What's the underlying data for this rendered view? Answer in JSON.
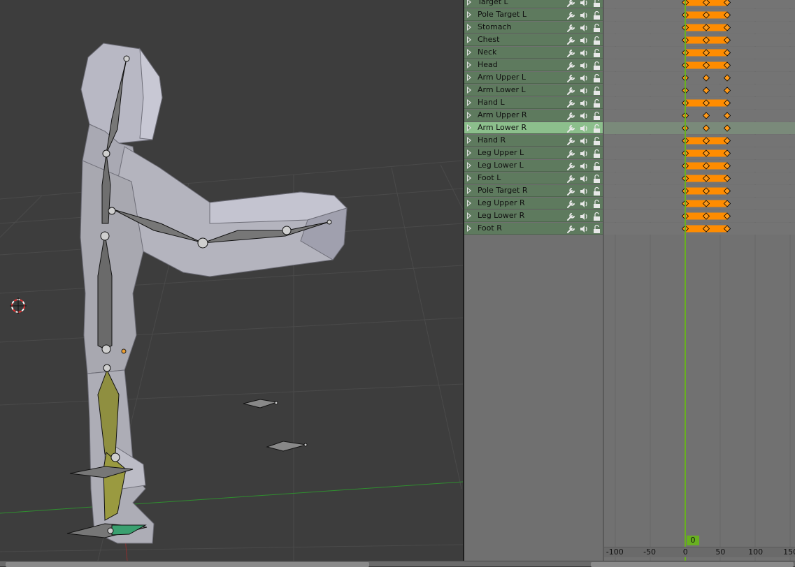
{
  "dopesheet": {
    "channels": [
      {
        "name": "Target L",
        "selected": false,
        "bar": true
      },
      {
        "name": "Pole Target L",
        "selected": false,
        "bar": true
      },
      {
        "name": "Stomach",
        "selected": false,
        "bar": true
      },
      {
        "name": "Chest",
        "selected": false,
        "bar": true
      },
      {
        "name": "Neck",
        "selected": false,
        "bar": true
      },
      {
        "name": "Head",
        "selected": false,
        "bar": true
      },
      {
        "name": "Arm Upper L",
        "selected": false,
        "bar": false
      },
      {
        "name": "Arm Lower L",
        "selected": false,
        "bar": false
      },
      {
        "name": "Hand L",
        "selected": false,
        "bar": true
      },
      {
        "name": "Arm Upper R",
        "selected": false,
        "bar": false
      },
      {
        "name": "Arm Lower R",
        "selected": true,
        "bar": false
      },
      {
        "name": "Hand R",
        "selected": false,
        "bar": true
      },
      {
        "name": "Leg Upper L",
        "selected": false,
        "bar": true
      },
      {
        "name": "Leg Lower L",
        "selected": false,
        "bar": true
      },
      {
        "name": "Foot L",
        "selected": false,
        "bar": true
      },
      {
        "name": "Pole Target R",
        "selected": false,
        "bar": true
      },
      {
        "name": "Leg Upper R",
        "selected": false,
        "bar": true
      },
      {
        "name": "Leg Lower R",
        "selected": false,
        "bar": true
      },
      {
        "name": "Foot R",
        "selected": false,
        "bar": true
      }
    ],
    "channel_icons": [
      "wrench-icon",
      "speaker-icon",
      "lock-icon"
    ],
    "keyframes": [
      0,
      30,
      60
    ],
    "ruler": {
      "labels": [
        "-100",
        "-50",
        "0",
        "50",
        "100",
        "150"
      ],
      "current_frame": "0"
    },
    "colors": {
      "keyframe": "#ff9a1a",
      "hold_bar": "#ff8c00",
      "current_frame": "#68b020",
      "channel": "#5e7a5e",
      "channel_selected": "#8cbf8c"
    }
  },
  "viewport": {
    "background": "#3d3d3d",
    "grid_axis_x_color": "#2f8f2f",
    "grid_axis_y_color": "#8f2f2f"
  }
}
